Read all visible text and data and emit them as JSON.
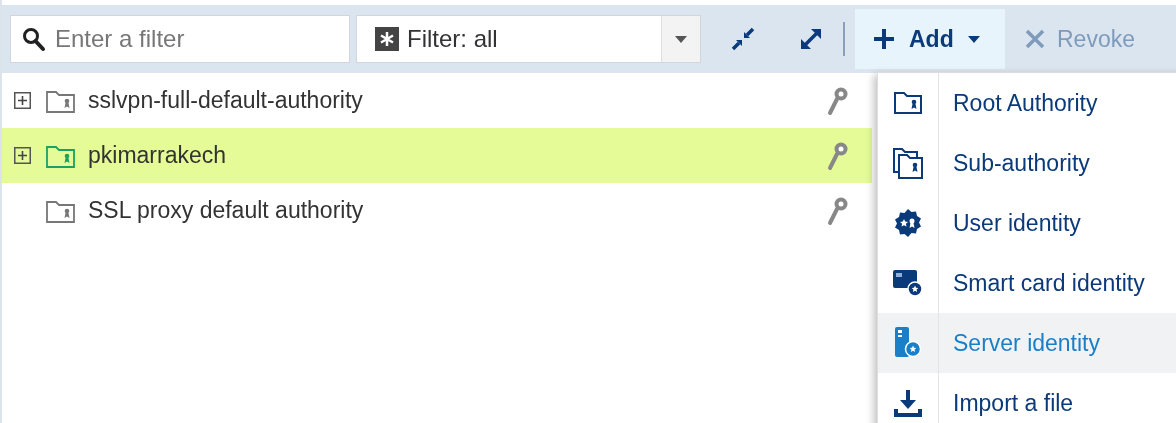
{
  "toolbar": {
    "filter": {
      "placeholder": "Enter a filter"
    },
    "type_filter": {
      "value": "Filter: all"
    },
    "add_button": {
      "label": "Add",
      "expanded": true
    },
    "revoke_button": {
      "label": "Revoke",
      "disabled": true
    }
  },
  "tree": [
    {
      "name": "sslvpn-full-default-authority",
      "has_children": true,
      "selected": false
    },
    {
      "name": "pkimarrakech",
      "has_children": true,
      "selected": true
    },
    {
      "name": "SSL proxy default authority",
      "has_children": false,
      "selected": false
    }
  ],
  "add_menu": [
    {
      "kind": "root",
      "label": "Root Authority",
      "highlighted": false
    },
    {
      "kind": "sub",
      "label": "Sub-authority",
      "highlighted": false
    },
    {
      "kind": "user",
      "label": "User identity",
      "highlighted": false
    },
    {
      "kind": "smartcard",
      "label": "Smart card identity",
      "highlighted": false
    },
    {
      "kind": "server",
      "label": "Server identity",
      "highlighted": true
    },
    {
      "kind": "import",
      "label": "Import a file",
      "highlighted": false
    }
  ]
}
